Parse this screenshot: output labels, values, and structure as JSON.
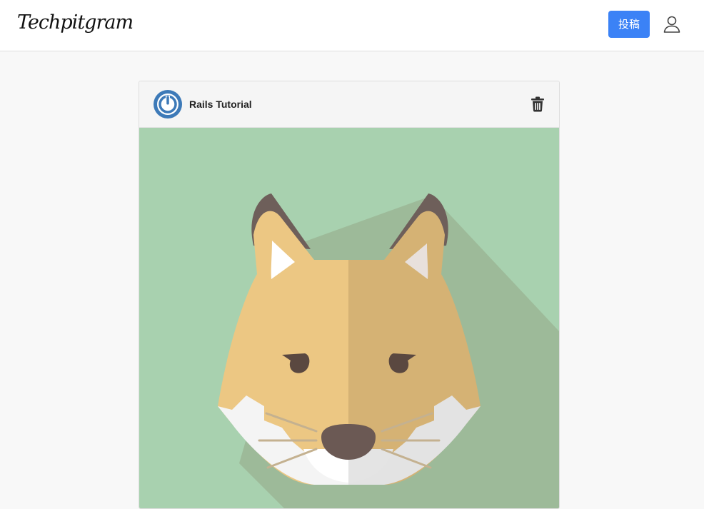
{
  "app": {
    "brand": "Techpitgram"
  },
  "header": {
    "post_button_label": "投稿",
    "user_icon": "user-icon"
  },
  "post": {
    "username": "Rails Tutorial",
    "avatar_icon": "power-icon",
    "delete_icon": "trash-icon",
    "image_subject": "fox-face-illustration"
  },
  "colors": {
    "accent": "#3b82f6",
    "image_background": "#a8d1af",
    "avatar_blue": "#3d7ab8"
  }
}
